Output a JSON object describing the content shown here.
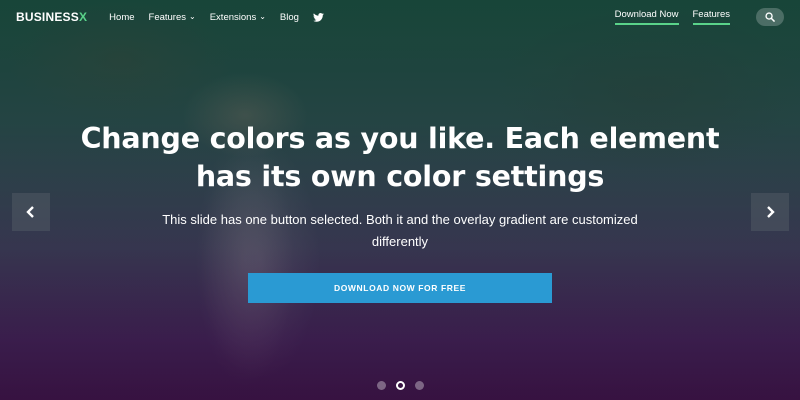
{
  "navbar": {
    "logo_main": "BUSINESS",
    "logo_accent": "X",
    "links": [
      {
        "label": "Home"
      },
      {
        "label": "Features"
      },
      {
        "label": "Extensions"
      },
      {
        "label": "Blog"
      }
    ],
    "twitter_icon": "twitter-icon",
    "download_label": "Download Now",
    "features_label": "Features",
    "search_icon": "search-icon"
  },
  "hero": {
    "headline_line1": "Change colors as you like. Each element",
    "headline_line2": "has its own color settings",
    "subtitle": "This slide has one button selected. Both it and the overlay gradient are customized differently",
    "cta_label": "DOWNLOAD NOW FOR FREE"
  },
  "slider": {
    "prev_icon": "chevron-left-icon",
    "next_icon": "chevron-right-icon",
    "active_dot": 2,
    "dot_count": 3
  },
  "colors": {
    "accent_green": "#5ad38a",
    "button_blue": "#2a9ad3"
  }
}
